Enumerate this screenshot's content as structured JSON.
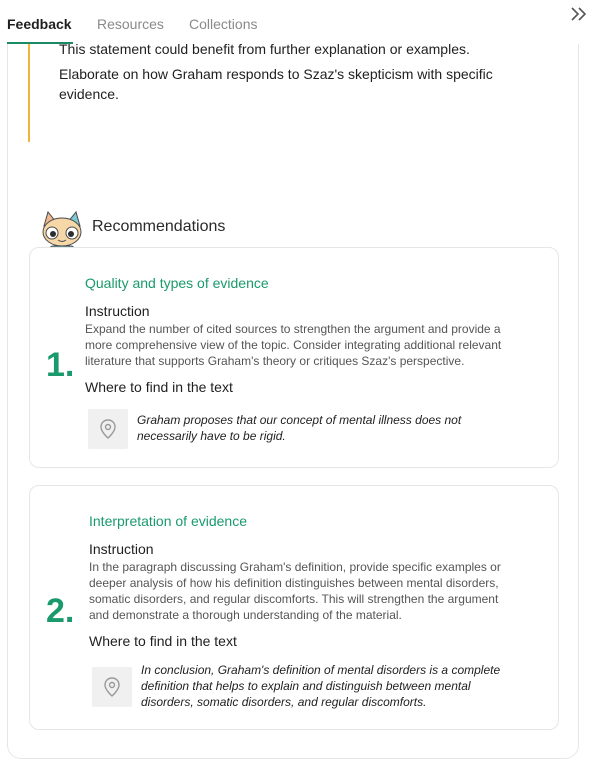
{
  "tabs": [
    {
      "label": "Feedback",
      "active": true
    },
    {
      "label": "Resources",
      "active": false
    },
    {
      "label": "Collections",
      "active": false
    }
  ],
  "colors": {
    "accent": "#1a9a6c",
    "quote_bar": "#f0b43a"
  },
  "icons": {
    "collapse": "double-chevron-right-icon",
    "location": "map-pin-icon",
    "mascot": "cat-robot-mascot"
  },
  "feedback": {
    "lines": [
      "This statement could benefit from further explanation or examples.",
      "Elaborate on how Graham responds to Szaz's skepticism with specific",
      "evidence."
    ]
  },
  "recommendations": {
    "title": "Recommendations",
    "items": [
      {
        "number": "1.",
        "title": "Quality and types of evidence",
        "instruction_label": "Instruction",
        "instruction_lines": [
          "Expand the number of cited sources to strengthen the argument and provide a",
          "more comprehensive view of the topic. Consider integrating additional relevant",
          "literature that supports Graham's theory or critiques Szaz's perspective."
        ],
        "where_label": "Where to find in the text",
        "quote_lines": [
          "Graham proposes that our concept of mental illness does not",
          "necessarily have to be rigid."
        ]
      },
      {
        "number": "2.",
        "title": "Interpretation of evidence",
        "instruction_label": "Instruction",
        "instruction_lines": [
          "In the paragraph discussing Graham's definition, provide specific examples or",
          "deeper analysis of how his definition distinguishes between mental disorders,",
          "somatic disorders, and regular discomforts. This will strengthen the argument",
          "and demonstrate a thorough understanding of the material."
        ],
        "where_label": "Where to find in the text",
        "quote_lines": [
          "In conclusion, Graham's definition of mental disorders is a complete",
          "definition that helps to explain and distinguish between mental",
          "disorders, somatic disorders, and regular discomforts."
        ]
      }
    ]
  }
}
